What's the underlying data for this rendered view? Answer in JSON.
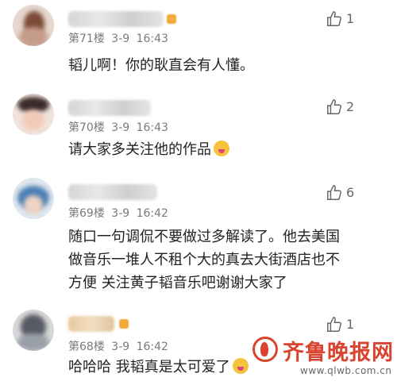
{
  "comments": [
    {
      "floor": "第71楼",
      "date": "3-9",
      "time": "16:43",
      "text": "韬儿啊！你的耿直会有人懂。",
      "likes": "1",
      "emoji": null
    },
    {
      "floor": "第70楼",
      "date": "3-9",
      "time": "16:43",
      "text": "请大家多关注他的作品",
      "likes": "2",
      "emoji": "flushed-face"
    },
    {
      "floor": "第69楼",
      "date": "3-9",
      "time": "16:42",
      "text_lines": [
        "随口一句调侃不要做过多解读了。他去美国",
        "做音乐一堆人不租个大的真去大街酒店也不",
        "方便 关注黄子韬音乐吧谢谢大家了"
      ],
      "likes": "6",
      "emoji": null
    },
    {
      "floor": "第68楼",
      "date": "3-9",
      "time": "16:42",
      "text": "哈哈哈 我韬真是太可爱了",
      "likes": "1",
      "emoji": "laughing-face"
    }
  ],
  "watermark": {
    "title": "齐鲁晚报网",
    "url": "www.qlwb.com.cn"
  },
  "colors": {
    "text": "#222222",
    "meta": "#7a7a7a",
    "watermark": "#d8442f"
  }
}
